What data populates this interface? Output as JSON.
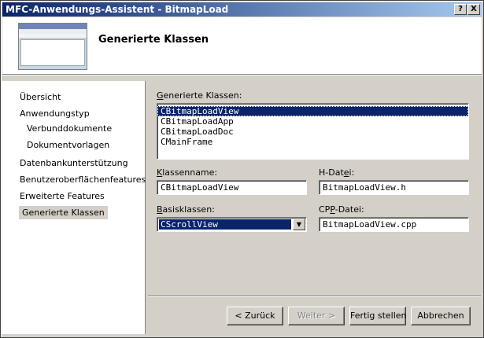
{
  "window": {
    "title": "MFC-Anwendungs-Assistent - BitmapLoad",
    "help_label": "?",
    "close_label": "X"
  },
  "header": {
    "title": "Generierte Klassen"
  },
  "sidebar": {
    "items": [
      {
        "label": "Übersicht"
      },
      {
        "label": "Anwendungstyp"
      },
      {
        "label": "Verbunddokumente"
      },
      {
        "label": "Dokumentvorlagen"
      },
      {
        "label": "Datenbankunterstützung"
      },
      {
        "label": "Benutzeroberflächenfeatures"
      },
      {
        "label": "Erweiterte Features"
      },
      {
        "label": "Generierte Klassen"
      }
    ]
  },
  "main": {
    "classes_label_underline": "G",
    "classes_label_rest": "enerierte Klassen:",
    "classes": [
      "CBitmapLoadView",
      "CBitmapLoadApp",
      "CBitmapLoadDoc",
      "CMainFrame"
    ],
    "classname_label_underline": "K",
    "classname_label_rest": "lassenname:",
    "classname_value": "CBitmapLoadView",
    "hfile_label_pre": "H-Dat",
    "hfile_label_underline": "e",
    "hfile_label_post": "i:",
    "hfile_value": "BitmapLoadView.h",
    "baseclass_label_underline": "B",
    "baseclass_label_rest": "asisklassen:",
    "baseclass_value": "CScrollView",
    "cppfile_label_pre": "CP",
    "cppfile_label_underline": "P",
    "cppfile_label_post": "-Datei:",
    "cppfile_value": "BitmapLoadView.cpp"
  },
  "footer": {
    "back_label": "< Zurück",
    "next_label": "Weiter >",
    "finish_label": "Fertig stellen",
    "cancel_label": "Abbrechen"
  }
}
